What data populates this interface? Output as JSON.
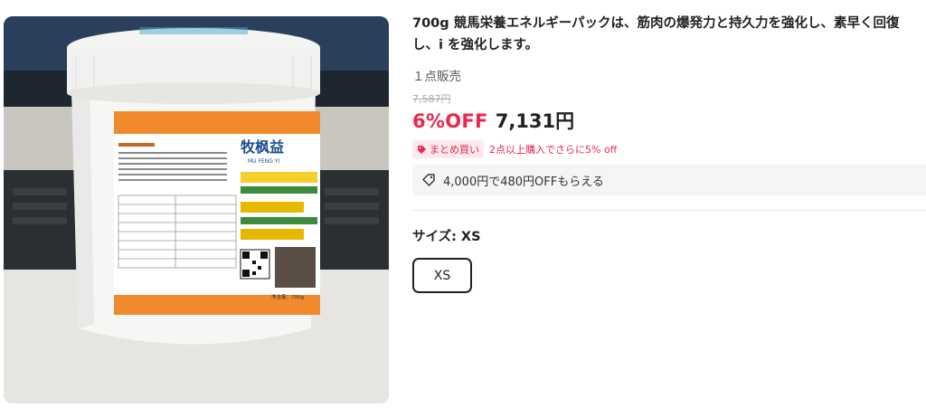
{
  "product": {
    "title_line1": "700g 競馬栄養エネルギーパックは、筋肉の爆発力と持久力を強化し、素早く回復",
    "title_line2": "し、i を強化します。",
    "sold_count": "１点販売",
    "original_price": "7,587円",
    "discount_label": "6%OFF",
    "price": "7,131円"
  },
  "bundle": {
    "badge_label": "まとめ買い",
    "text": "2点以上購入でさらに5% off"
  },
  "coupon": {
    "text": "4,000円で480円OFFもらえる"
  },
  "size": {
    "label": "サイズ: XS",
    "options": [
      "XS"
    ]
  },
  "image_label": {
    "brand": "牧枫益",
    "brand_romaji": "MU FENG YI",
    "net_weight": "净含量：700g"
  },
  "colors": {
    "accent": "#e8284f",
    "badge_bg": "#fde8ec",
    "coupon_bg": "#f5f5f5",
    "label_orange": "#f08a2c"
  }
}
